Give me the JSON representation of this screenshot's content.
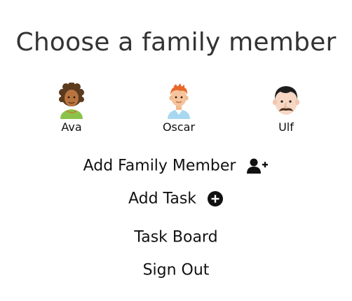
{
  "page": {
    "title": "Choose a family member"
  },
  "members": [
    {
      "name": "Ava",
      "avatar": "girl-curly-hair-avatar"
    },
    {
      "name": "Oscar",
      "avatar": "boy-red-hair-avatar"
    },
    {
      "name": "Ulf",
      "avatar": "man-mustache-avatar"
    }
  ],
  "actions": {
    "add_family_member": {
      "label": "Add Family Member",
      "icon": "add-user-icon"
    },
    "add_task": {
      "label": "Add Task",
      "icon": "plus-circle-icon"
    },
    "task_board": {
      "label": "Task Board"
    },
    "sign_out": {
      "label": "Sign Out"
    }
  },
  "colors": {
    "text": "#111111",
    "title": "#333333",
    "background": "#ffffff"
  }
}
